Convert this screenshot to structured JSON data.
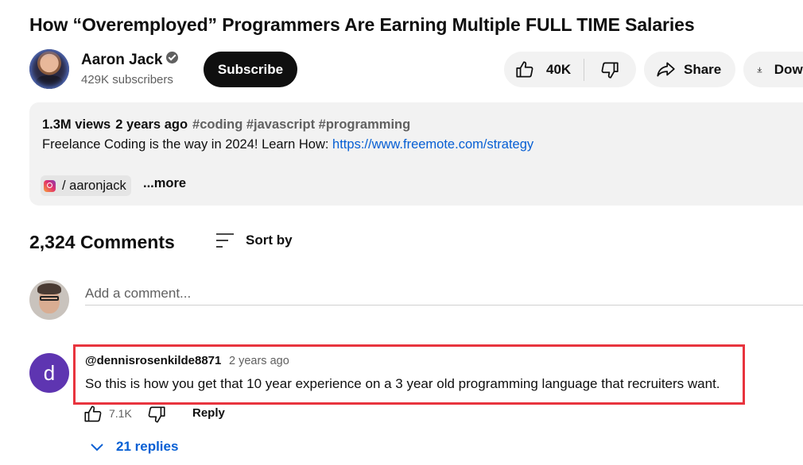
{
  "video": {
    "title": "How “Overemployed” Programmers Are Earning Multiple FULL TIME Salaries",
    "views": "1.3M views",
    "age": "2 years ago",
    "tags": "#coding #javascript #programming",
    "description_prefix": "Freelance Coding is the way in 2024! Learn How: ",
    "description_link": "https://www.freemote.com/strategy",
    "social_handle": "/ aaronjack",
    "more_label": "...more"
  },
  "channel": {
    "name": "Aaron Jack",
    "subscribers": "429K subscribers",
    "subscribe_label": "Subscribe"
  },
  "actions": {
    "likes": "40K",
    "share_label": "Share",
    "download_label": "Download"
  },
  "comments": {
    "count_label": "2,324 Comments",
    "sort_label": "Sort by",
    "add_placeholder": "Add a comment...",
    "items": [
      {
        "avatar_letter": "d",
        "avatar_color": "#5e35b1",
        "author": "@dennisrosenkilde8871",
        "time": "2 years ago",
        "text": "So this is how you get that 10 year experience on a 3 year old programming language that recruiters want.",
        "likes": "7.1K",
        "reply_label": "Reply",
        "replies_label": "21 replies"
      }
    ]
  },
  "colors": {
    "link": "#065fd4",
    "highlight": "#e8343e",
    "pill_bg": "#f2f2f2"
  }
}
